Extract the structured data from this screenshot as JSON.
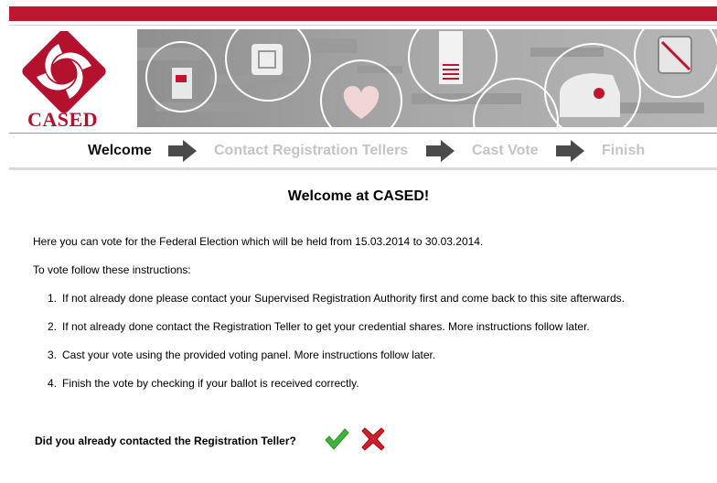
{
  "brand": {
    "logo_text": "CASED"
  },
  "steps": [
    {
      "label": "Welcome",
      "active": true
    },
    {
      "label": "Contact Registration Tellers",
      "active": false
    },
    {
      "label": "Cast Vote",
      "active": false
    },
    {
      "label": "Finish",
      "active": false
    }
  ],
  "content": {
    "heading": "Welcome at CASED!",
    "intro": "Here you can vote for the Federal Election which will be held from 15.03.2014 to 30.03.2014.",
    "instructions_intro": "To vote follow these instructions:",
    "instructions": [
      {
        "num": "1.",
        "text": "If not already done please contact your Supervised Registration Authority first and come back to this site afterwards."
      },
      {
        "num": "2.",
        "text": "If not already done contact the Registration Teller to get your credential shares. More instructions follow later."
      },
      {
        "num": "3.",
        "text": "Cast your vote using the provided voting panel. More instructions follow later."
      },
      {
        "num": "4.",
        "text": "Finish the vote by checking if your ballot is received correctly."
      }
    ],
    "question": "Did you already contacted the Registration Teller?"
  },
  "icons": {
    "logo": "cased-logo",
    "step_arrow": "arrow-right-icon",
    "yes": "checkmark-icon",
    "no": "x-icon"
  },
  "colors": {
    "brand_red": "#c0152f",
    "yes_green": "#3fb33a",
    "no_red": "#d0202a",
    "step_inactive": "#c4c4c4"
  }
}
